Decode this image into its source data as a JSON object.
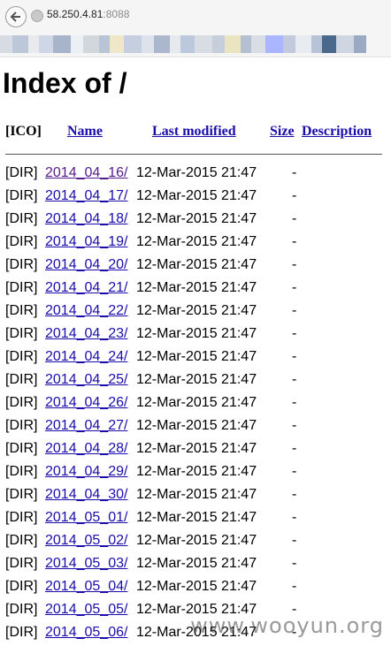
{
  "browser": {
    "url_host": "58.250.4.81",
    "url_port": ":8088",
    "icons": {
      "back": "back-arrow-icon",
      "site": "site-info-icon"
    },
    "bookmark_colors": [
      "#d7dbe3",
      "#bcc7d9",
      "#e9eaee",
      "#cfd7e6",
      "#a8b4c9",
      "#eceff4",
      "#d2d6dd",
      "#b9c4d6",
      "#efe7c7",
      "#c5cfdf",
      "#dde3ec",
      "#aab7cc",
      "#e6e9ee",
      "#bcc8dc",
      "#d8dce3",
      "#c6cedc",
      "#ebe4c1",
      "#b5bfd2",
      "#d9dee6",
      "#aab6ff",
      "#c2cadb",
      "#e8ebf0",
      "#b8c3d7",
      "#4b6a8b",
      "#cfd6e2",
      "#9ba9c2"
    ]
  },
  "page": {
    "title": "Index of /",
    "headers": {
      "icon": "[ICO]",
      "name": "Name",
      "last_modified": "Last modified",
      "size": "Size",
      "description": "Description"
    },
    "rows": [
      {
        "icon": "[DIR]",
        "name": "2014_04_16/",
        "date": "12-Mar-2015 21:47",
        "size": "-",
        "visited": true
      },
      {
        "icon": "[DIR]",
        "name": "2014_04_17/",
        "date": "12-Mar-2015 21:47",
        "size": "-"
      },
      {
        "icon": "[DIR]",
        "name": "2014_04_18/",
        "date": "12-Mar-2015 21:47",
        "size": "-"
      },
      {
        "icon": "[DIR]",
        "name": "2014_04_19/",
        "date": "12-Mar-2015 21:47",
        "size": "-"
      },
      {
        "icon": "[DIR]",
        "name": "2014_04_20/",
        "date": "12-Mar-2015 21:47",
        "size": "-"
      },
      {
        "icon": "[DIR]",
        "name": "2014_04_21/",
        "date": "12-Mar-2015 21:47",
        "size": "-"
      },
      {
        "icon": "[DIR]",
        "name": "2014_04_22/",
        "date": "12-Mar-2015 21:47",
        "size": "-"
      },
      {
        "icon": "[DIR]",
        "name": "2014_04_23/",
        "date": "12-Mar-2015 21:47",
        "size": "-"
      },
      {
        "icon": "[DIR]",
        "name": "2014_04_24/",
        "date": "12-Mar-2015 21:47",
        "size": "-"
      },
      {
        "icon": "[DIR]",
        "name": "2014_04_25/",
        "date": "12-Mar-2015 21:47",
        "size": "-"
      },
      {
        "icon": "[DIR]",
        "name": "2014_04_26/",
        "date": "12-Mar-2015 21:47",
        "size": "-"
      },
      {
        "icon": "[DIR]",
        "name": "2014_04_27/",
        "date": "12-Mar-2015 21:47",
        "size": "-"
      },
      {
        "icon": "[DIR]",
        "name": "2014_04_28/",
        "date": "12-Mar-2015 21:47",
        "size": "-"
      },
      {
        "icon": "[DIR]",
        "name": "2014_04_29/",
        "date": "12-Mar-2015 21:47",
        "size": "-"
      },
      {
        "icon": "[DIR]",
        "name": "2014_04_30/",
        "date": "12-Mar-2015 21:47",
        "size": "-"
      },
      {
        "icon": "[DIR]",
        "name": "2014_05_01/",
        "date": "12-Mar-2015 21:47",
        "size": "-"
      },
      {
        "icon": "[DIR]",
        "name": "2014_05_02/",
        "date": "12-Mar-2015 21:47",
        "size": "-"
      },
      {
        "icon": "[DIR]",
        "name": "2014_05_03/",
        "date": "12-Mar-2015 21:47",
        "size": "-"
      },
      {
        "icon": "[DIR]",
        "name": "2014_05_04/",
        "date": "12-Mar-2015 21:47",
        "size": "-"
      },
      {
        "icon": "[DIR]",
        "name": "2014_05_05/",
        "date": "12-Mar-2015 21:47",
        "size": "-"
      },
      {
        "icon": "[DIR]",
        "name": "2014_05_06/",
        "date": "12-Mar-2015 21:47",
        "size": "-"
      }
    ]
  },
  "watermark": "www.wooyun.org"
}
